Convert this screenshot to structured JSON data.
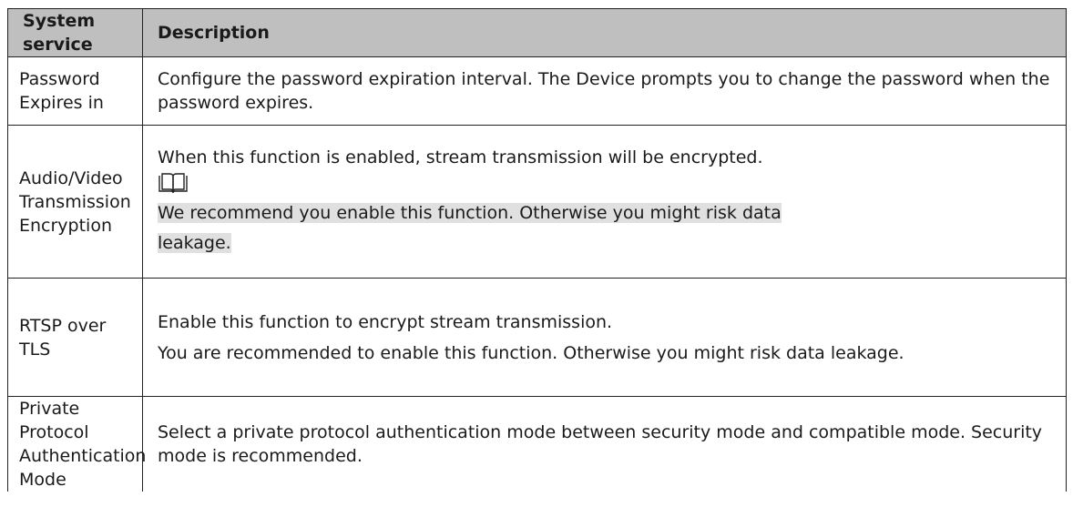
{
  "table": {
    "headers": {
      "service": "System service",
      "description": "Description"
    },
    "rows": [
      {
        "service": "Password Expires in",
        "paragraphs": [
          "Configure the password expiration interval. The Device prompts you to change the password when the password expires."
        ]
      },
      {
        "service": "Audio/Video Transmission Encryption",
        "paragraphs": [
          "When this function is enabled, stream transmission will be encrypted."
        ],
        "note_icon": "book-note-icon",
        "note_lines": [
          "We recommend you enable this function. Otherwise you might risk data",
          "leakage."
        ]
      },
      {
        "service": "RTSP over TLS",
        "paragraphs": [
          "Enable this function to encrypt stream transmission.",
          "You are recommended to enable this function. Otherwise you might risk data leakage."
        ]
      },
      {
        "service": "Private Protocol Authentication Mode",
        "paragraphs": [
          "Select a private protocol authentication mode between security mode and compatible mode. Security mode is recommended."
        ]
      }
    ]
  }
}
